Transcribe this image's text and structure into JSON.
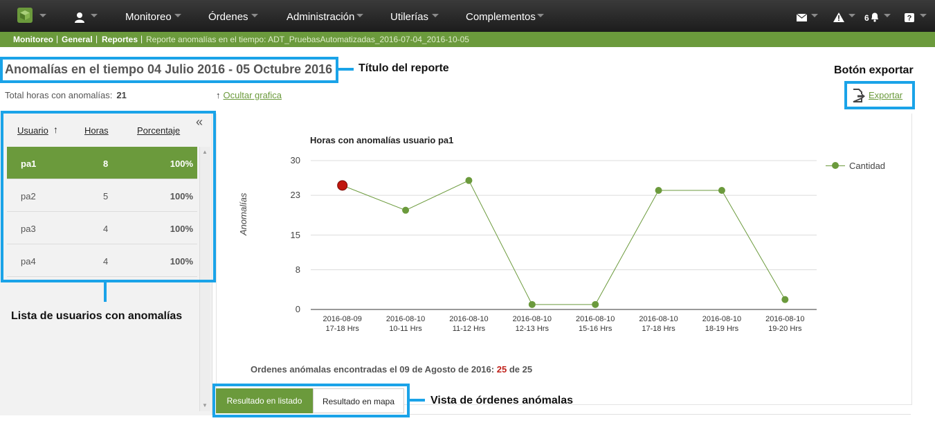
{
  "nav": {
    "items": [
      "Monitoreo",
      "Órdenes",
      "Administración",
      "Utilerías",
      "Complementos"
    ],
    "notification_count": "6"
  },
  "breadcrumb": {
    "items": [
      "Monitoreo",
      "General",
      "Reportes"
    ],
    "separator": "|",
    "current": "Reporte anomalías en el tiempo: ADT_PruebasAutomatizadas_2016-07-04_2016-10-05"
  },
  "report": {
    "title": "Anomalías en el tiempo 04 Julio 2016 - 05 Octubre 2016",
    "total_label": "Total horas con anomalías:",
    "total_value": "21",
    "hide_chart": "Ocultar grafica",
    "export": "Exportar"
  },
  "annotations": {
    "title": "Título del reporte",
    "export": "Botón exportar",
    "list": "Lista de usuarios con anomalías",
    "orders": "Vista de órdenes anómalas"
  },
  "user_list": {
    "headers": [
      "Usuario",
      "Horas",
      "Porcentaje"
    ],
    "rows": [
      {
        "user": "pa1",
        "hours": "8",
        "pct": "100%"
      },
      {
        "user": "pa2",
        "hours": "5",
        "pct": "100%"
      },
      {
        "user": "pa3",
        "hours": "4",
        "pct": "100%"
      },
      {
        "user": "pa4",
        "hours": "4",
        "pct": "100%"
      }
    ]
  },
  "chart_data": {
    "type": "line",
    "title": "Horas con anomalías usuario pa1",
    "ylabel": "Anomalías",
    "xlabel": "",
    "ylim": [
      0,
      30
    ],
    "yticks": [
      "0",
      "8",
      "15",
      "23",
      "30"
    ],
    "categories": [
      [
        "2016-08-09",
        "17-18 Hrs"
      ],
      [
        "2016-08-10",
        "10-11 Hrs"
      ],
      [
        "2016-08-10",
        "11-12 Hrs"
      ],
      [
        "2016-08-10",
        "12-13 Hrs"
      ],
      [
        "2016-08-10",
        "15-16 Hrs"
      ],
      [
        "2016-08-10",
        "17-18 Hrs"
      ],
      [
        "2016-08-10",
        "18-19 Hrs"
      ],
      [
        "2016-08-10",
        "19-20 Hrs"
      ]
    ],
    "series": [
      {
        "name": "Cantidad",
        "values": [
          25,
          20,
          26,
          1,
          1,
          24,
          24,
          2
        ],
        "color": "#6b9a3c",
        "highlight_index": 0,
        "highlight_color": "#c0170e"
      }
    ],
    "grid": true,
    "legend": "right"
  },
  "orders": {
    "prefix": "Ordenes anómalas encontradas el 09 de Agosto de 2016:",
    "found": "25",
    "of": "de",
    "total": "25"
  },
  "tabs": [
    "Resultado en listado",
    "Resultado en mapa"
  ],
  "colors": {
    "accent": "#6b9a3c",
    "annotation": "#1aa3e8",
    "topbar": "#2a2a2a"
  }
}
